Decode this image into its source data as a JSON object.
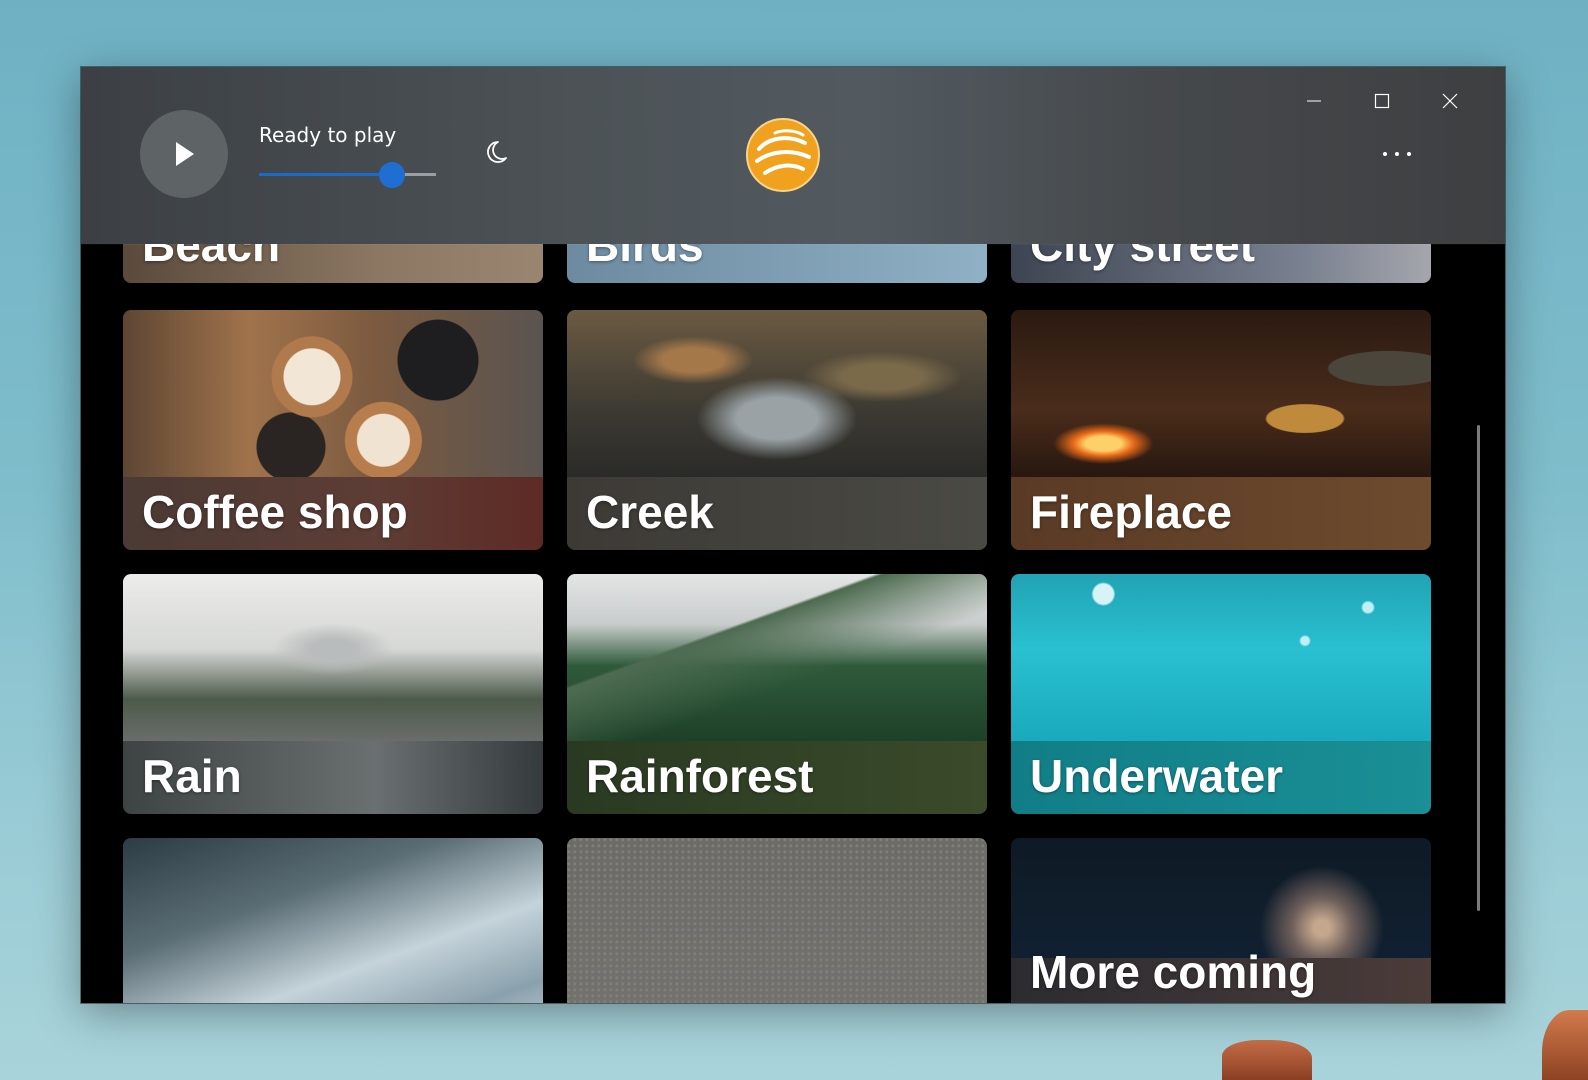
{
  "player": {
    "status": "Ready to play",
    "volume_percent": 75
  },
  "window_controls": {
    "minimize_icon": "minimize-icon",
    "maximize_icon": "maximize-icon",
    "close_icon": "close-icon"
  },
  "tiles": [
    {
      "label": "Beach"
    },
    {
      "label": "Birds"
    },
    {
      "label": "City street"
    },
    {
      "label": "Coffee shop"
    },
    {
      "label": "Creek"
    },
    {
      "label": "Fireplace"
    },
    {
      "label": "Rain"
    },
    {
      "label": "Rainforest"
    },
    {
      "label": "Underwater"
    },
    {
      "label": ""
    },
    {
      "label": ""
    },
    {
      "label": "More coming"
    }
  ],
  "colors": {
    "accent": "#1f6fd2",
    "logo_orange": "#f0a21e"
  }
}
